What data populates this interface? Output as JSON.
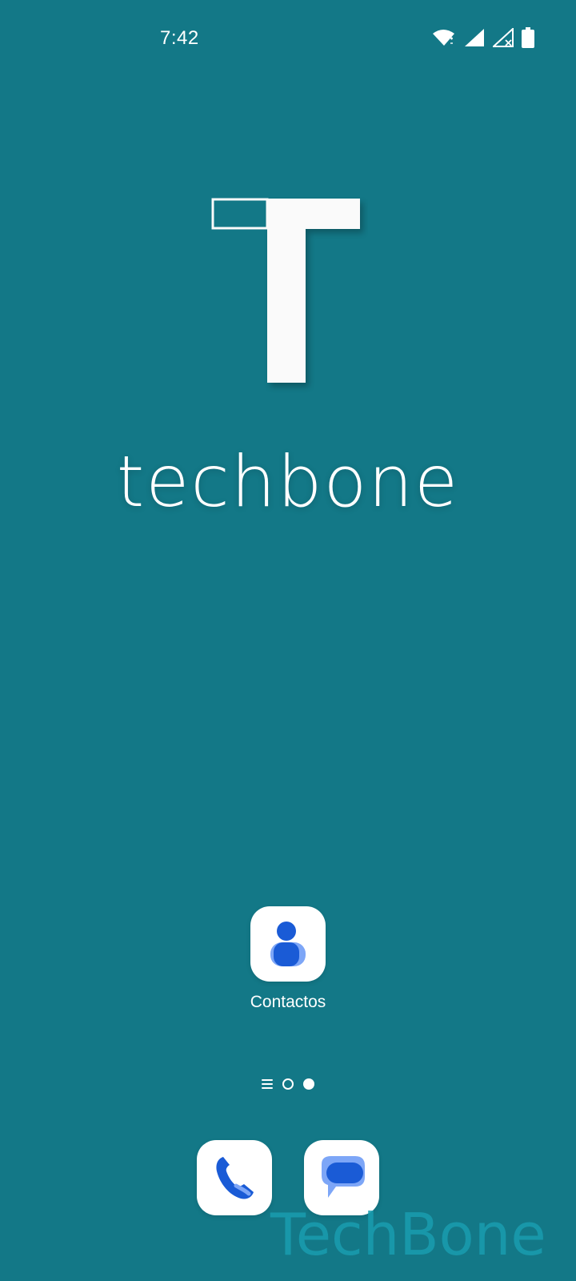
{
  "status_bar": {
    "time": "7:42",
    "icons": [
      "wifi-icon",
      "signal-icon",
      "signal-no-sim-icon",
      "battery-icon"
    ]
  },
  "wallpaper": {
    "logo_text": "techbone",
    "background_color": "#137887"
  },
  "home_apps": [
    {
      "label": "Contactos",
      "icon": "contacts-icon"
    }
  ],
  "page_indicator": {
    "pages": 2,
    "current_page": 2,
    "has_list_icon": true
  },
  "dock": [
    {
      "icon": "phone-icon"
    },
    {
      "icon": "messages-icon"
    }
  ],
  "watermark": "TechBone"
}
